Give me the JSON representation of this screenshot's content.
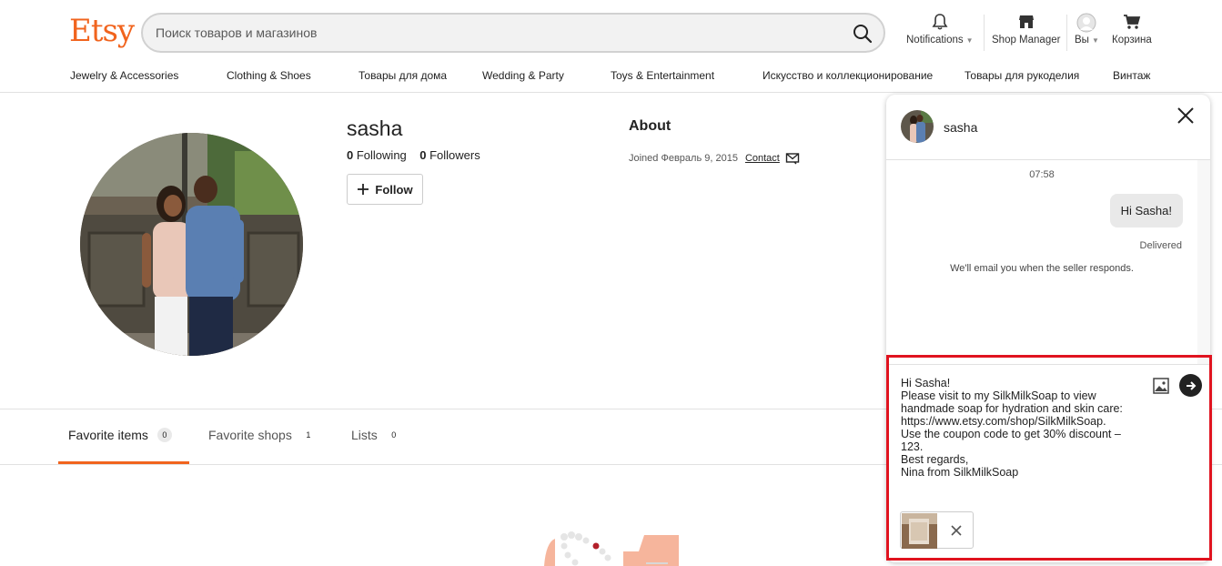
{
  "header": {
    "logo": "Etsy",
    "search_placeholder": "Поиск товаров и магазинов",
    "nav": {
      "notifications": "Notifications",
      "shop_manager": "Shop Manager",
      "you": "Вы",
      "cart": "Корзина"
    },
    "categories": [
      "Jewelry & Accessories",
      "Clothing & Shoes",
      "Товары для дома",
      "Wedding & Party",
      "Toys & Entertainment",
      "Искусство и коллекционирование",
      "Товары для рукоделия",
      "Винтаж"
    ]
  },
  "profile": {
    "name": "sasha",
    "following_count": "0",
    "following_label": "Following",
    "followers_count": "0",
    "followers_label": "Followers",
    "follow_label": "Follow",
    "about_title": "About",
    "joined_text": "Joined Февраль 9, 2015",
    "contact_label": "Contact"
  },
  "tabs": [
    {
      "label": "Favorite items",
      "count": "0"
    },
    {
      "label": "Favorite shops",
      "count": "1"
    },
    {
      "label": "Lists",
      "count": "0"
    }
  ],
  "chat": {
    "name": "sasha",
    "time": "07:58",
    "sent_message": "Hi Sasha!",
    "status": "Delivered",
    "note": "We'll email you when the seller responds.",
    "draft": "Hi Sasha!\nPlease visit to my SilkMilkSoap to view handmade soap for hydration and skin care:\nhttps://www.etsy.com/shop/SilkMilkSoap.\nUse the coupon code to get 30% discount – 123.\nBest regards,\nNina from SilkMilkSoap"
  },
  "colors": {
    "brand": "#f1641e",
    "highlight": "#e0131f",
    "send_button": "#222222"
  }
}
